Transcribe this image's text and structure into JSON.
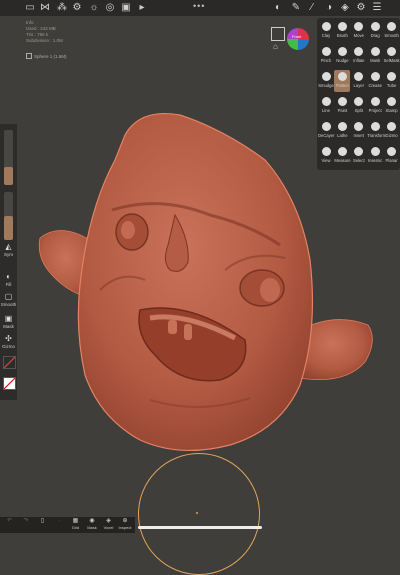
{
  "stats": {
    "lines": [
      "Info",
      "Used : 242 MB",
      "Tris : 786 k",
      "Subdivision : 1.0M"
    ]
  },
  "mesh": {
    "label": "Sphere 1 (1.6M)"
  },
  "gizmo": {
    "label": "Front"
  },
  "left_panel": {
    "sym": "Sym",
    "fill": "Fill",
    "smooth": "Smooth",
    "mask": "Mask",
    "gizmo": "Gizmo",
    "radius_value": 0.32,
    "intensity_value": 0.5
  },
  "tools": [
    {
      "label": "Clay",
      "icon": "clay-icon"
    },
    {
      "label": "Brush",
      "icon": "brush-icon"
    },
    {
      "label": "Move",
      "icon": "move-icon"
    },
    {
      "label": "Drag",
      "icon": "drag-icon"
    },
    {
      "label": "Smooth",
      "icon": "smooth-icon"
    },
    {
      "label": "Pinch",
      "icon": "pinch-icon"
    },
    {
      "label": "Nudge",
      "icon": "nudge-icon"
    },
    {
      "label": "Inflate",
      "icon": "inflate-icon"
    },
    {
      "label": "Mask",
      "icon": "mask-icon"
    },
    {
      "label": "SelMask",
      "icon": "selmask-icon"
    },
    {
      "label": "Smudge",
      "icon": "smudge-icon"
    },
    {
      "label": "Flatten",
      "icon": "flatten-icon",
      "active": true
    },
    {
      "label": "Layer",
      "icon": "layer-icon"
    },
    {
      "label": "Crease",
      "icon": "crease-icon"
    },
    {
      "label": "Tube",
      "icon": "tube-icon"
    },
    {
      "label": "Line",
      "icon": "line-icon"
    },
    {
      "label": "Paint",
      "icon": "paint-icon"
    },
    {
      "label": "Split",
      "icon": "split-icon"
    },
    {
      "label": "Project",
      "icon": "project-icon"
    },
    {
      "label": "Stamp",
      "icon": "stamp-icon"
    },
    {
      "label": "DeCayer",
      "icon": "decayer-icon"
    },
    {
      "label": "Lathe",
      "icon": "lathe-icon"
    },
    {
      "label": "Insert",
      "icon": "insert-icon"
    },
    {
      "label": "Transform",
      "icon": "transform-icon"
    },
    {
      "label": "Gizmo",
      "icon": "gizmo-icon"
    },
    {
      "label": "View",
      "icon": "camera-icon"
    },
    {
      "label": "Measure",
      "icon": "measure-icon"
    },
    {
      "label": "Select",
      "icon": "select-icon"
    },
    {
      "label": "Insemic",
      "icon": "insemic-icon"
    },
    {
      "label": "Planar",
      "icon": "planar-icon"
    }
  ],
  "bottom_bar": [
    {
      "label": "",
      "icon": "undo-icon",
      "dim": true
    },
    {
      "label": "",
      "icon": "redo-icon",
      "dim": true
    },
    {
      "label": "",
      "icon": "file-icon",
      "dim": false
    },
    {
      "label": "",
      "icon": "blank-icon",
      "dim": true
    },
    {
      "label": "Grid",
      "icon": "grid-icon",
      "dim": false
    },
    {
      "label": "Mask",
      "icon": "mask-toggle-icon",
      "dim": false
    },
    {
      "label": "Voxel",
      "icon": "voxel-icon",
      "dim": false
    },
    {
      "label": "Inspect",
      "icon": "inspect-icon",
      "dim": false
    }
  ],
  "colors": {
    "clay": "#b85e45",
    "accent": "#a0785b",
    "brush_ring": "#e0a35a"
  }
}
